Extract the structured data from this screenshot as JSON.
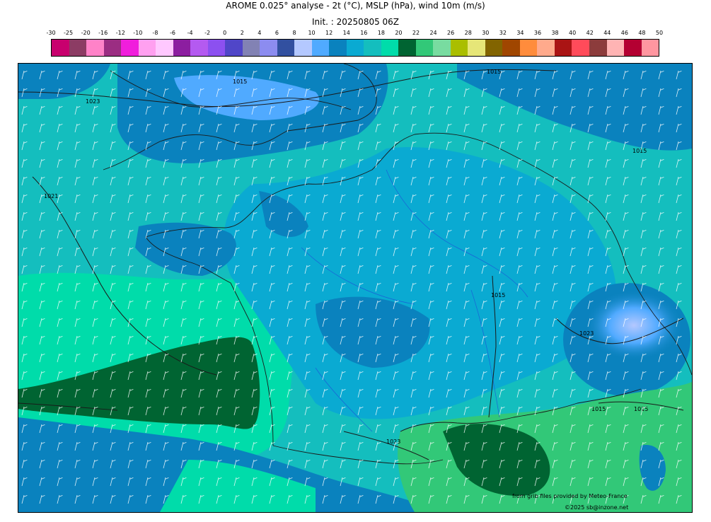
{
  "header": {
    "title": "AROME 0.025° analyse - 2t (°C), MSLP (hPa), wind 10m (m/s)",
    "init": "Init. : 20250805 06Z"
  },
  "colorbar": {
    "ticks": [
      "-30",
      "-25",
      "-20",
      "-16",
      "-12",
      "-10",
      "-8",
      "-6",
      "-4",
      "-2",
      "0",
      "2",
      "4",
      "6",
      "8",
      "10",
      "12",
      "14",
      "16",
      "18",
      "20",
      "22",
      "24",
      "26",
      "28",
      "30",
      "32",
      "34",
      "36",
      "38",
      "40",
      "42",
      "44",
      "46",
      "48",
      "50"
    ],
    "colors": [
      "#c8006e",
      "#8c3c64",
      "#ff82c8",
      "#9b2d82",
      "#f01edc",
      "#ffa0f0",
      "#ffc8ff",
      "#8c1ea0",
      "#b45af0",
      "#8c50f0",
      "#5046c8",
      "#8282b4",
      "#8c8cf0",
      "#3250a0",
      "#b4c8ff",
      "#50aaff",
      "#0a82be",
      "#0aaad2",
      "#14bebe",
      "#00dcaa",
      "#006432",
      "#32c878",
      "#78dca0",
      "#aabe00",
      "#e6e678",
      "#826400",
      "#a04600",
      "#ff8c3c",
      "#ffaa8c",
      "#aa1414",
      "#ff4b5a",
      "#8c3c3c",
      "#ffb4b4",
      "#b40032",
      "#ff96a0"
    ]
  },
  "map": {
    "isobar_labels": [
      "1015",
      "1023",
      "1021",
      "1015",
      "1015",
      "1023",
      "1023",
      "1015",
      "1015",
      "1015"
    ],
    "credit_source": "from grib files provided by Meteo-France",
    "credit_copyright": "©2025 sb@inzone.net"
  }
}
